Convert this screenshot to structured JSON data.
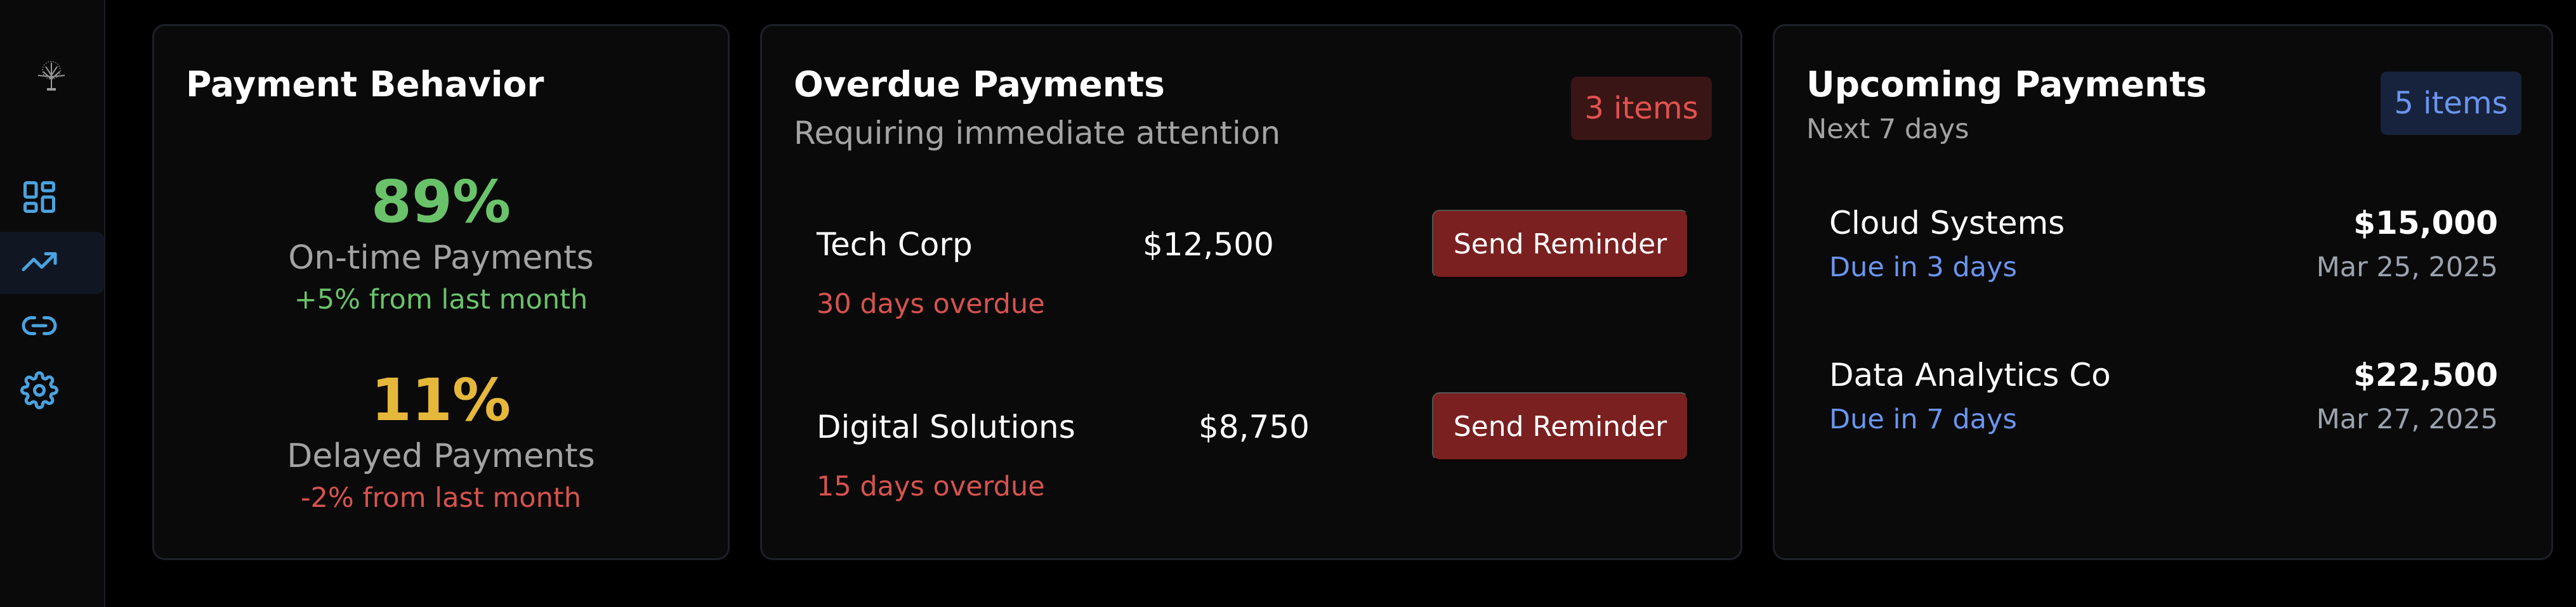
{
  "sidebar": {
    "logo_icon": "tree-icon",
    "items": [
      {
        "name": "dashboard",
        "icon": "grid-icon",
        "active": false
      },
      {
        "name": "analytics",
        "icon": "trending-up-icon",
        "active": true
      },
      {
        "name": "links",
        "icon": "link-icon",
        "active": false
      },
      {
        "name": "settings",
        "icon": "gear-icon",
        "active": false
      }
    ]
  },
  "behavior": {
    "title": "Payment Behavior",
    "ontime": {
      "value": "89%",
      "label": "On-time Payments",
      "change": "+5% from last month"
    },
    "delayed": {
      "value": "11%",
      "label": "Delayed Payments",
      "change": "-2% from last month"
    }
  },
  "overdue": {
    "title": "Overdue Payments",
    "subtitle": "Requiring immediate attention",
    "badge": "3 items",
    "rows": [
      {
        "name": "Tech Corp",
        "amount": "$12,500",
        "status": "30 days overdue",
        "button": "Send Reminder"
      },
      {
        "name": "Digital Solutions",
        "amount": "$8,750",
        "status": "15 days overdue",
        "button": "Send Reminder"
      }
    ]
  },
  "upcoming": {
    "title": "Upcoming Payments",
    "subtitle": "Next 7 days",
    "badge": "5 items",
    "rows": [
      {
        "name": "Cloud Systems",
        "due": "Due in 3 days",
        "amount": "$15,000",
        "date": "Mar 25, 2025"
      },
      {
        "name": "Data Analytics Co",
        "due": "Due in 7 days",
        "amount": "$22,500",
        "date": "Mar 27, 2025"
      }
    ]
  },
  "colors": {
    "positive": "#6ac36a",
    "warning": "#e5b73b",
    "danger": "#d6534f",
    "info": "#6b95ef",
    "icon_accent": "#4aa3df"
  }
}
